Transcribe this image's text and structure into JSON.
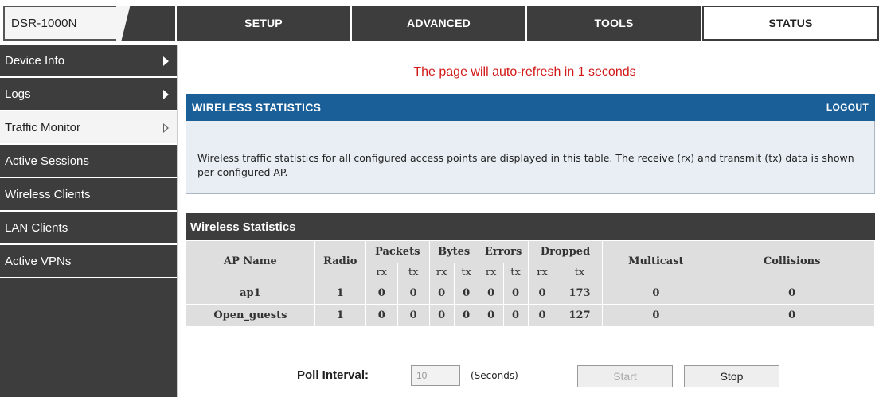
{
  "brand": {
    "model": "DSR-1000N",
    "slashes": "///"
  },
  "nav": {
    "tabs": [
      {
        "label": "SETUP",
        "active": false
      },
      {
        "label": "ADVANCED",
        "active": false
      },
      {
        "label": "TOOLS",
        "active": false
      },
      {
        "label": "STATUS",
        "active": true
      }
    ]
  },
  "sidebar": {
    "items": [
      {
        "label": "Device Info",
        "arrow": true,
        "active": false
      },
      {
        "label": "Logs",
        "arrow": true,
        "active": false
      },
      {
        "label": "Traffic Monitor",
        "arrow": true,
        "active": true
      },
      {
        "label": "Active Sessions",
        "arrow": false,
        "active": false
      },
      {
        "label": "Wireless Clients",
        "arrow": false,
        "active": false
      },
      {
        "label": "LAN Clients",
        "arrow": false,
        "active": false
      },
      {
        "label": "Active VPNs",
        "arrow": false,
        "active": false
      }
    ]
  },
  "main": {
    "refresh_notice": "The page will auto-refresh in 1 seconds",
    "section_title": "WIRELESS STATISTICS",
    "logout_label": "LOGOUT",
    "description": "Wireless traffic statistics for all configured access points are displayed in this table. The receive (rx) and transmit (tx) data is shown per configured AP.",
    "table": {
      "title": "Wireless Statistics",
      "headers": {
        "ap_name": "AP Name",
        "radio": "Radio",
        "packets": "Packets",
        "bytes": "Bytes",
        "errors": "Errors",
        "dropped": "Dropped",
        "multicast": "Multicast",
        "collisions": "Collisions",
        "rx": "rx",
        "tx": "tx"
      },
      "rows": [
        {
          "ap_name": "ap1",
          "radio": "1",
          "packets_rx": "0",
          "packets_tx": "0",
          "bytes_rx": "0",
          "bytes_tx": "0",
          "errors_rx": "0",
          "errors_tx": "0",
          "dropped_rx": "0",
          "dropped_tx": "173",
          "multicast": "0",
          "collisions": "0"
        },
        {
          "ap_name": "Open_guests",
          "radio": "1",
          "packets_rx": "0",
          "packets_tx": "0",
          "bytes_rx": "0",
          "bytes_tx": "0",
          "errors_rx": "0",
          "errors_tx": "0",
          "dropped_rx": "0",
          "dropped_tx": "127",
          "multicast": "0",
          "collisions": "0"
        }
      ]
    },
    "poll": {
      "label": "Poll Interval:",
      "value": "10",
      "unit": "(Seconds)",
      "start_label": "Start",
      "stop_label": "Stop"
    }
  },
  "colors": {
    "nav_dark": "#3d3d3d",
    "header_blue": "#1b5f99",
    "refresh_red": "#d11919",
    "cell_gray": "#dedede"
  }
}
